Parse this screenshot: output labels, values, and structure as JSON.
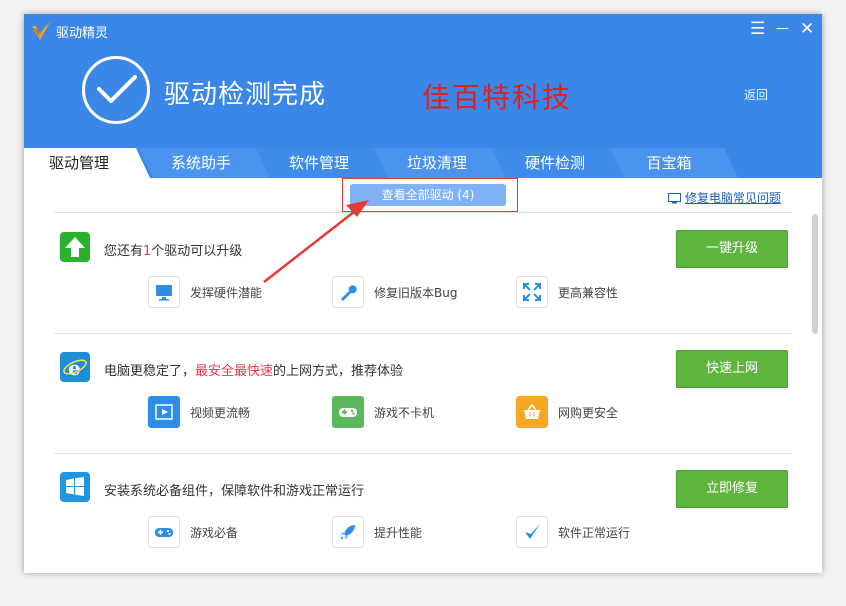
{
  "app": {
    "title": "驱动精灵"
  },
  "window_controls": {
    "menu": "☰",
    "minimize": "—",
    "close": "✕"
  },
  "header": {
    "title": "驱动检测完成",
    "watermark": "佳百特科技",
    "back": "返回"
  },
  "tabs": [
    {
      "label": "驱动管理",
      "active": true
    },
    {
      "label": "系统助手",
      "active": false
    },
    {
      "label": "软件管理",
      "active": false
    },
    {
      "label": "垃圾清理",
      "active": false
    },
    {
      "label": "硬件检测",
      "active": false
    },
    {
      "label": "百宝箱",
      "active": false
    }
  ],
  "toolbar": {
    "view_all": "查看全部驱动 (4)",
    "faq": "修复电脑常见问题"
  },
  "sections": [
    {
      "text_pre": "您还有",
      "text_hl": "1",
      "text_post": "个驱动可以升级",
      "button": "一键升级",
      "icon": "upgrade-arrow-icon",
      "features": [
        {
          "label": "发挥硬件潜能",
          "icon": "monitor-icon"
        },
        {
          "label": "修复旧版本Bug",
          "icon": "wrench-icon"
        },
        {
          "label": "更高兼容性",
          "icon": "expand-icon"
        }
      ]
    },
    {
      "text_pre": "电脑更稳定了，",
      "text_hl": "最安全最快速",
      "text_post": "的上网方式，推荐体验",
      "button": "快速上网",
      "icon": "ie-browser-icon",
      "features": [
        {
          "label": "视频更流畅",
          "icon": "video-icon"
        },
        {
          "label": "游戏不卡机",
          "icon": "gamepad-icon"
        },
        {
          "label": "网购更安全",
          "icon": "basket-icon"
        }
      ]
    },
    {
      "text_pre": "安装系统必备组件，保障软件和游戏正常运行",
      "text_hl": "",
      "text_post": "",
      "button": "立即修复",
      "icon": "windows-icon",
      "features": [
        {
          "label": "游戏必备",
          "icon": "controller-icon"
        },
        {
          "label": "提升性能",
          "icon": "rocket-icon"
        },
        {
          "label": "软件正常运行",
          "icon": "check-icon"
        }
      ]
    }
  ],
  "colors": {
    "header_blue": "#3b87e8",
    "button_green": "#5fb53d",
    "highlight_red": "#e8384f",
    "annotation_red": "#e53935"
  }
}
